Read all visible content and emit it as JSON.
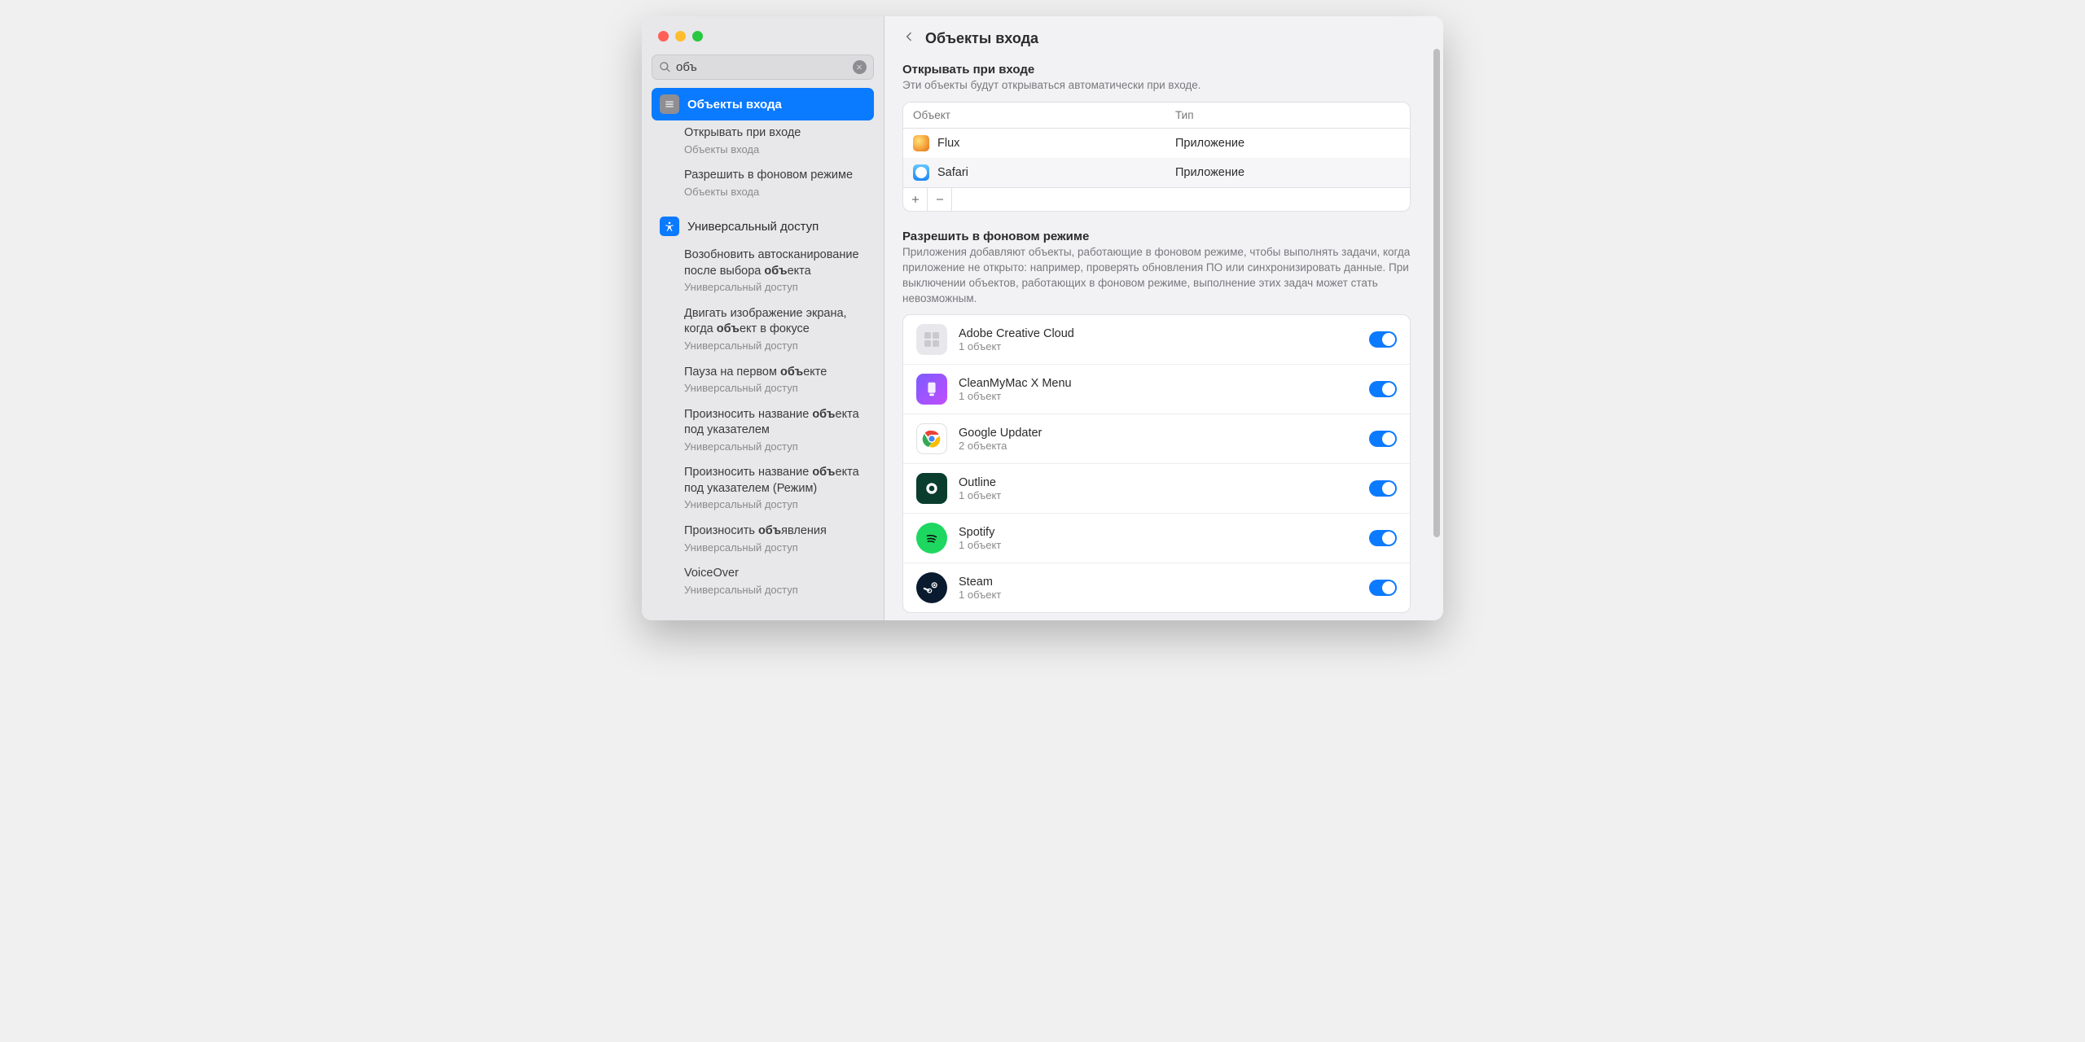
{
  "search": {
    "value": "объ"
  },
  "sidebar": {
    "mainItems": [
      {
        "label": "Объекты входа"
      }
    ],
    "subItems1": [
      {
        "title_html": "Открывать при входе",
        "cat": "Объекты входа"
      },
      {
        "title_html": "Разрешить в фоновом режиме",
        "cat": "Объекты входа"
      }
    ],
    "accessLabel": "Универсальный доступ",
    "subItems2": [
      {
        "title_html": "Возобновить автосканирование после выбора <strong>объ</strong>екта",
        "cat": "Универсальный доступ"
      },
      {
        "title_html": "Двигать изображение экрана, когда <strong>объ</strong>ект в фокусе",
        "cat": "Универсальный доступ"
      },
      {
        "title_html": "Пауза на первом <strong>объ</strong>екте",
        "cat": "Универсальный доступ"
      },
      {
        "title_html": "Произносить название <strong>объ</strong>екта под указателем",
        "cat": "Универсальный доступ"
      },
      {
        "title_html": "Произносить название <strong>объ</strong>екта под указателем (Режим)",
        "cat": "Универсальный доступ"
      },
      {
        "title_html": "Произносить <strong>объ</strong>явления",
        "cat": "Универсальный доступ"
      },
      {
        "title_html": "VoiceOver",
        "cat": "Универсальный доступ"
      }
    ]
  },
  "page": {
    "title": "Объекты входа",
    "openAtLogin": {
      "heading": "Открывать при входе",
      "desc": "Эти объекты будут открываться автоматически при входе.",
      "cols": {
        "item": "Объект",
        "type": "Тип"
      },
      "rows": [
        {
          "name": "Flux",
          "type": "Приложение",
          "iconClass": "flux"
        },
        {
          "name": "Safari",
          "type": "Приложение",
          "iconClass": "safari"
        }
      ]
    },
    "background": {
      "heading": "Разрешить в фоновом режиме",
      "desc": "Приложения добавляют объекты, работающие в фоновом режиме, чтобы выполнять задачи, когда приложение не открыто: например, проверять обновления ПО или синхронизировать данные. При выключении объектов, работающих в фоновом режиме, выполнение этих задач может стать невозможным.",
      "items": [
        {
          "name": "Adobe Creative Cloud",
          "sub": "1 объект",
          "iconClass": "ic-adobe",
          "on": true
        },
        {
          "name": "CleanMyMac X Menu",
          "sub": "1 объект",
          "iconClass": "ic-cmm",
          "on": true
        },
        {
          "name": "Google Updater",
          "sub": "2 объекта",
          "iconClass": "ic-chrome",
          "on": true
        },
        {
          "name": "Outline",
          "sub": "1 объект",
          "iconClass": "ic-outline",
          "on": true
        },
        {
          "name": "Spotify",
          "sub": "1 объект",
          "iconClass": "ic-spotify",
          "on": true
        },
        {
          "name": "Steam",
          "sub": "1 объект",
          "iconClass": "ic-steam",
          "on": true
        }
      ]
    }
  }
}
